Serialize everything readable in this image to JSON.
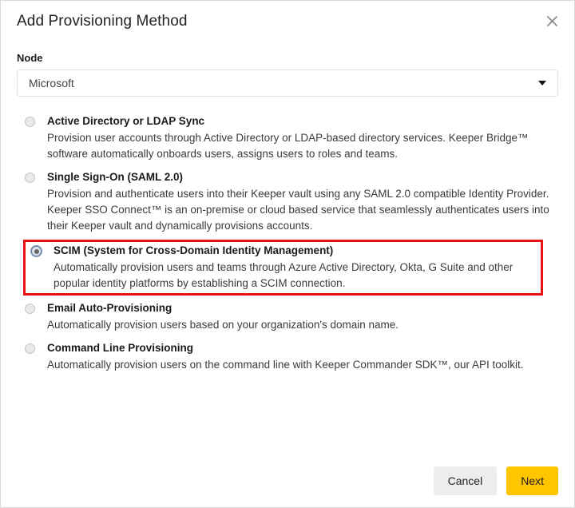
{
  "dialog": {
    "title": "Add Provisioning Method",
    "close_icon": "close-icon"
  },
  "node_field": {
    "label": "Node",
    "value": "Microsoft",
    "arrow_icon": "chevron-down-icon"
  },
  "options": [
    {
      "title": "Active Directory or LDAP Sync",
      "desc": "Provision user accounts through Active Directory or LDAP-based directory services. Keeper Bridge™ software automatically onboards users, assigns users to roles and teams.",
      "selected": false,
      "highlighted": false
    },
    {
      "title": "Single Sign-On (SAML 2.0)",
      "desc": "Provision and authenticate users into their Keeper vault using any SAML 2.0 compatible Identity Provider. Keeper SSO Connect™ is an on-premise or cloud based service that seamlessly authenticates users into their Keeper vault and dynamically provisions accounts.",
      "selected": false,
      "highlighted": false
    },
    {
      "title": "SCIM (System for Cross-Domain Identity Management)",
      "desc": "Automatically provision users and teams through Azure Active Directory, Okta, G Suite and other popular identity platforms by establishing a SCIM connection.",
      "selected": true,
      "highlighted": true
    },
    {
      "title": "Email Auto-Provisioning",
      "desc": "Automatically provision users based on your organization's domain name.",
      "selected": false,
      "highlighted": false
    },
    {
      "title": "Command Line Provisioning",
      "desc": "Automatically provision users on the command line with Keeper Commander SDK™, our API toolkit.",
      "selected": false,
      "highlighted": false
    }
  ],
  "footer": {
    "cancel_label": "Cancel",
    "next_label": "Next"
  },
  "colors": {
    "highlight_border": "#e81212",
    "primary_button": "#ffc600",
    "secondary_button": "#ededed"
  }
}
